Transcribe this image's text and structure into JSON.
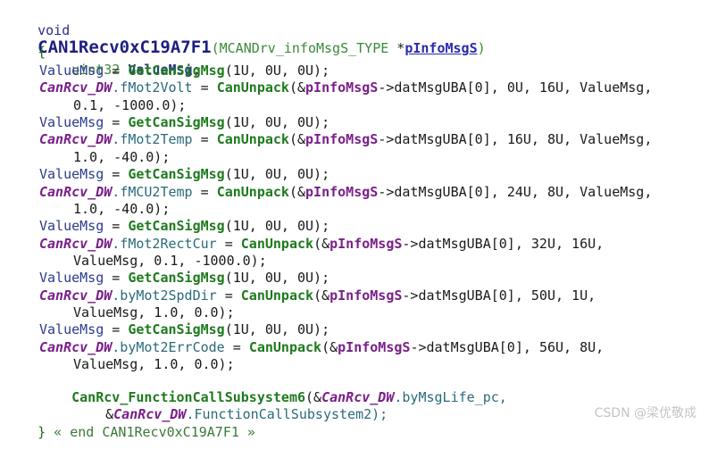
{
  "editor": {
    "signature": {
      "ret": "void",
      "name": "CAN1Recv0xC19A7F1",
      "open": "(",
      "param_type": "MCANDrv_infoMsgS_TYPE",
      "star": " *",
      "param": "pInfoMsgS",
      "close": ")"
    },
    "open_brace": "{",
    "decl": {
      "type": "uint32",
      "name": "ValueMsg",
      "semi": ";"
    },
    "get": {
      "lhs": "ValueMsg",
      "eq": " = ",
      "fn": "GetCanSigMsg",
      "args": "(1U, 0U, 0U);"
    },
    "unpack": {
      "obj": "CanRcv_DW",
      "fn": "CanUnpack",
      "amp": "(&",
      "ptr": "pInfoMsgS",
      "member": "->datMsgUBA[0], "
    },
    "assignments": [
      {
        "field": ".fMot2Volt",
        "args1": "0U, 16U, ValueMsg,",
        "args2": "0.1, -1000.0);"
      },
      {
        "field": ".fMot2Temp",
        "args1": "16U, 8U, ValueMsg,",
        "args2": "1.0, -40.0);"
      },
      {
        "field": ".fMCU2Temp",
        "args1": "24U, 8U, ValueMsg,",
        "args2": "1.0, -40.0);"
      },
      {
        "field": ".fMot2RectCur",
        "args1": "32U, 16U,",
        "args2": "ValueMsg, 0.1, -1000.0);"
      },
      {
        "field": ".byMot2SpdDir",
        "args1": "50U, 1U,",
        "args2": "ValueMsg, 1.0, 0.0);"
      },
      {
        "field": ".byMot2ErrCode",
        "args1": "56U, 8U,",
        "args2": "ValueMsg, 1.0, 0.0);"
      }
    ],
    "final_call": {
      "fn": "CanRcv_FunctionCallSubsystem6",
      "amp1": "(&",
      "obj": "CanRcv_DW",
      "field1": ".byMsgLife_pc,",
      "amp2": "&",
      "field2": ".FunctionCallSubsystem2);"
    },
    "close_brace": "}",
    "end_comment": " « end CAN1Recv0xC19A7F1 »"
  },
  "watermark": "CSDN @梁优敬成"
}
